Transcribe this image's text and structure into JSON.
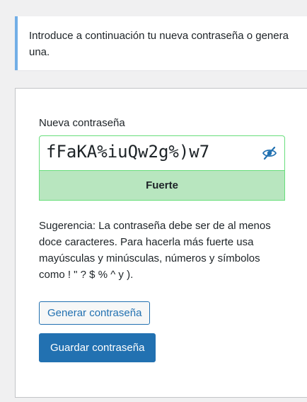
{
  "notice": {
    "text": "Introduce a continuación tu nueva contraseña o genera una."
  },
  "form": {
    "password_label": "Nueva contraseña",
    "password_value": "fFaKA%iuQw2g%)w7",
    "toggle_icon": "eye-slash-icon",
    "strength_label": "Fuerte",
    "hint": "Sugerencia: La contraseña debe ser de al menos doce caracteres. Para hacerla más fuerte usa mayúsculas y minúsculas, números y símbolos como ! \" ? $ % ^ y ).",
    "generate_button": "Generar contraseña",
    "save_button": "Guardar contraseña"
  },
  "colors": {
    "accent": "#2271b1",
    "notice_border": "#72aee6",
    "strong_bg": "#b8e6bf",
    "strong_border": "#68de7c"
  }
}
